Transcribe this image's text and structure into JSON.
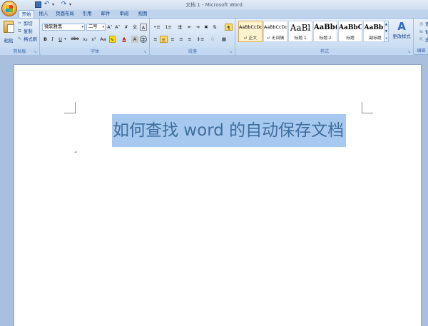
{
  "window": {
    "title": "文档 1 - Microsoft Word"
  },
  "tabs": [
    "开始",
    "插入",
    "页面布局",
    "引用",
    "邮件",
    "审阅",
    "视图"
  ],
  "active_tab": "开始",
  "clipboard": {
    "paste": "粘贴",
    "cut": "剪切",
    "copy": "复制",
    "format_painter": "格式刷",
    "group_label": "剪贴板"
  },
  "font": {
    "font_name": "微软雅黑",
    "font_size": "二号",
    "grow": "A˄",
    "shrink": "A˅",
    "bold": "B",
    "italic": "I",
    "underline": "U",
    "strikethrough": "abe",
    "subscript": "x₂",
    "superscript": "x²",
    "change_case": "Aa",
    "font_color": "A",
    "char_shading": "A",
    "group_label": "字体"
  },
  "paragraph": {
    "group_label": "段落"
  },
  "styles": {
    "items": [
      {
        "sample": "AaBbCcDd",
        "name": "↵ 正文",
        "selected": true
      },
      {
        "sample": "AaBbCcDd",
        "name": "↵ 无间隔",
        "selected": false
      },
      {
        "sample": "AaBl",
        "name": "标题 1",
        "selected": false
      },
      {
        "sample": "AaBb(",
        "name": "标题 2",
        "selected": false
      },
      {
        "sample": "AaBbC",
        "name": "标题",
        "selected": false
      },
      {
        "sample": "AaBb(",
        "name": "副标题",
        "selected": false
      }
    ],
    "change_styles": "更改样式",
    "group_label": "样式"
  },
  "editing": {
    "find": "查找",
    "replace": "替换",
    "select": "选择",
    "group_label": "编辑"
  },
  "document": {
    "title_text": "如何查找 word 的自动保存文档"
  },
  "colors": {
    "selection": "#a8c9ef",
    "title_text": "#3e6f9e",
    "ribbon_text": "#15428b"
  }
}
